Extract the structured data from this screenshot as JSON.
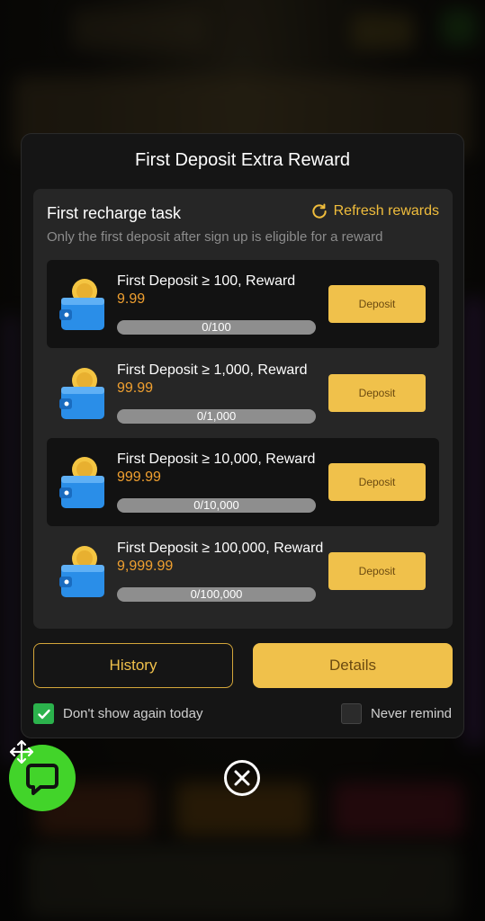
{
  "modal": {
    "title": "First Deposit Extra Reward",
    "task_title": "First recharge task",
    "refresh_label": "Refresh rewards",
    "subtitle": "Only the first deposit after sign up is eligible for a reward",
    "tasks": [
      {
        "prefix": "First Deposit ≥ 100, Reward ",
        "amount": "9.99",
        "progress": "0/100",
        "button": "Deposit"
      },
      {
        "prefix": "First Deposit ≥ 1,000, Reward ",
        "amount": "99.99",
        "progress": "0/1,000",
        "button": "Deposit"
      },
      {
        "prefix": "First Deposit ≥ 10,000, Reward ",
        "amount": "999.99",
        "progress": "0/10,000",
        "button": "Deposit"
      },
      {
        "prefix": "First Deposit ≥ 100,000, Reward ",
        "amount": "9,999.99",
        "progress": "0/100,000",
        "button": "Deposit"
      }
    ],
    "history_label": "History",
    "details_label": "Details",
    "dont_show_label": "Don't show again today",
    "dont_show_checked": true,
    "never_remind_label": "Never remind",
    "never_remind_checked": false
  },
  "icons": {
    "refresh": "refresh-icon",
    "wallet": "wallet-coin-icon",
    "close": "close-icon",
    "chat": "chat-icon",
    "move": "move-icon"
  },
  "colors": {
    "accent": "#f0c14b",
    "amount": "#f0a030",
    "check": "#2bb24c",
    "fab": "#42d42a"
  }
}
